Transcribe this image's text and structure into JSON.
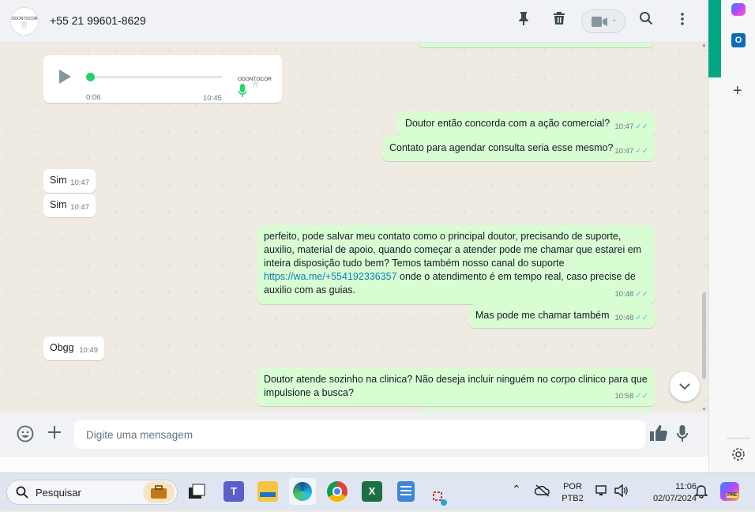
{
  "header": {
    "contact_name": "+55 21 99601-8629",
    "avatar_text": "ODONTOCOR",
    "icons": [
      "pin-icon",
      "trash-icon",
      "video-call-icon",
      "search-icon",
      "menu-icon"
    ]
  },
  "voice_message": {
    "elapsed": "0:06",
    "time": "10:45",
    "sender_label": "ODONTOCOR",
    "progress": 0
  },
  "messages": [
    {
      "text": "Doutor então concorda com a ação comercial?",
      "time": "10:47",
      "dir": "out"
    },
    {
      "text": "Contato para agendar consulta seria esse mesmo?",
      "time": "10:47",
      "dir": "out"
    },
    {
      "text": "Sim",
      "time": "10:47",
      "dir": "in"
    },
    {
      "text": "Sim",
      "time": "10:47",
      "dir": "in"
    },
    {
      "text_before": "perfeito, pode salvar meu contato como o principal doutor, precisando de suporte, auxilio, material de apoio, quando começar a atender pode me chamar que estarei em inteira disposição tudo bem? Temos também nosso canal do suporte ",
      "link": "https://wa.me/+554192336357",
      "text_after": " onde o atendimento é em tempo real, caso precise de auxilio com as guias.",
      "time": "10:48",
      "dir": "out"
    },
    {
      "text": "Mas pode me chamar também",
      "time": "10:48",
      "dir": "out"
    },
    {
      "text": "Obgg",
      "time": "10:49",
      "dir": "in"
    },
    {
      "text": "Doutor atende sozinho na clinica? Não deseja incluir ninguém no corpo clinico para que impulsione a busca?",
      "time": "10:58",
      "dir": "out"
    }
  ],
  "footer": {
    "placeholder": "Digite uma mensagem"
  },
  "taskbar": {
    "search_placeholder": "Pesquisar",
    "lang_top": "POR",
    "lang_bottom": "PTB2",
    "clock_time": "11:06",
    "clock_date": "02/07/2024",
    "copilot_badge": "PRE"
  },
  "colors": {
    "outgoing_bubble": "#d9fdd3",
    "incoming_bubble": "#ffffff",
    "chat_bg": "#efeae2",
    "accent": "#00a884",
    "ticks": "#53bdeb"
  }
}
